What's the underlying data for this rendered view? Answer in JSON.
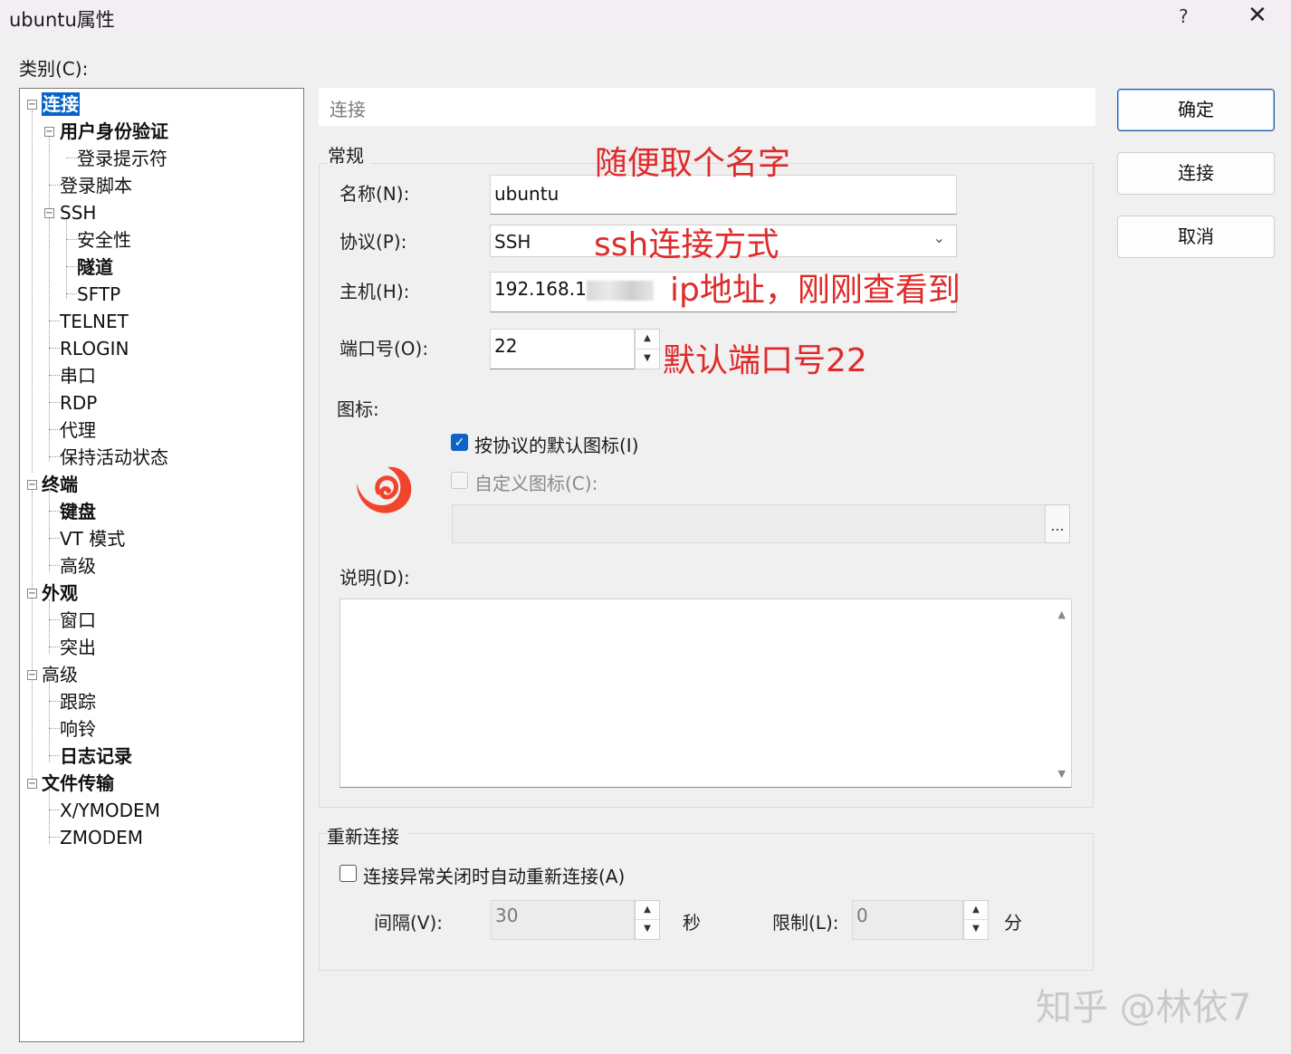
{
  "window": {
    "title": "ubuntu属性",
    "help": "?",
    "close": "✕"
  },
  "category_label": "类别(C):",
  "tree": {
    "items": [
      {
        "label": "连接"
      },
      {
        "label": "用户身份验证"
      },
      {
        "label": "登录提示符"
      },
      {
        "label": "登录脚本"
      },
      {
        "label": "SSH"
      },
      {
        "label": "安全性"
      },
      {
        "label": "隧道"
      },
      {
        "label": "SFTP"
      },
      {
        "label": "TELNET"
      },
      {
        "label": "RLOGIN"
      },
      {
        "label": "串口"
      },
      {
        "label": "RDP"
      },
      {
        "label": "代理"
      },
      {
        "label": "保持活动状态"
      },
      {
        "label": "终端"
      },
      {
        "label": "键盘"
      },
      {
        "label": "VT 模式"
      },
      {
        "label": "高级"
      },
      {
        "label": "外观"
      },
      {
        "label": "窗口"
      },
      {
        "label": "突出"
      },
      {
        "label": "高级"
      },
      {
        "label": "跟踪"
      },
      {
        "label": "响铃"
      },
      {
        "label": "日志记录"
      },
      {
        "label": "文件传输"
      },
      {
        "label": "X/YMODEM"
      },
      {
        "label": "ZMODEM"
      }
    ],
    "expander": "−"
  },
  "panel": {
    "header": "连接",
    "general": {
      "title": "常规",
      "name_label": "名称(N):",
      "name_value": "ubuntu",
      "protocol_label": "协议(P):",
      "protocol_value": "SSH",
      "host_label": "主机(H):",
      "host_value": "192.168.1",
      "port_label": "端口号(O):",
      "port_value": "22",
      "icon_label": "图标:",
      "default_icon_checkbox": "按协议的默认图标(I)",
      "custom_icon_checkbox": "自定义图标(C):",
      "browse": "...",
      "description_label": "说明(D):",
      "check_mark": "✓"
    },
    "reconnect": {
      "title": "重新连接",
      "auto_reconnect_checkbox": "连接异常关闭时自动重新连接(A)",
      "interval_label": "间隔(V):",
      "interval_value": "30",
      "interval_unit": "秒",
      "limit_label": "限制(L):",
      "limit_value": "0",
      "limit_unit": "分"
    }
  },
  "buttons": {
    "ok": "确定",
    "connect": "连接",
    "cancel": "取消"
  },
  "annotations": {
    "name": "随便取个名字",
    "protocol": "ssh连接方式",
    "host": "ip地址，刚刚查看到",
    "port": "默认端口号22"
  },
  "watermark": "知乎 @林依7",
  "colors": {
    "annotation": "#e02a2a",
    "selection": "#0a64c8",
    "logo": "#f0442c"
  }
}
